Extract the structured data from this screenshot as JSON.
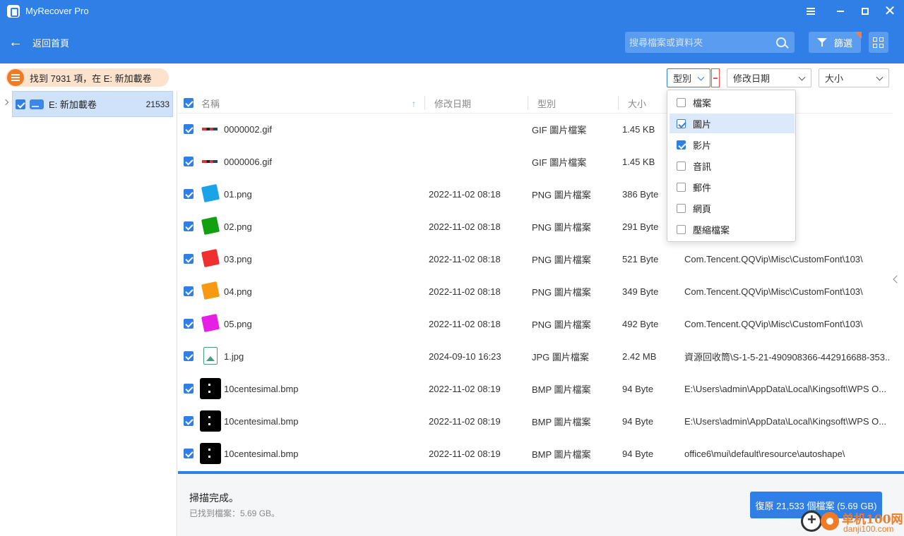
{
  "window": {
    "title": "MyRecover Pro"
  },
  "header": {
    "back_label": "返回首頁",
    "search_placeholder": "搜尋檔案或資料夾",
    "filter_label": "篩選"
  },
  "toolbar": {
    "summary": "找到 7931 項，在 E: 新加載卷",
    "type_dropdown": "型別",
    "date_dropdown": "修改日期",
    "size_dropdown": "大小"
  },
  "tree": {
    "drive_label": "E: 新加載卷",
    "drive_count": "21533"
  },
  "table": {
    "columns": {
      "name": "名稱",
      "date": "修改日期",
      "type": "型別",
      "size": "大小"
    },
    "rows": [
      {
        "name": "0000002.gif",
        "date": "",
        "type": "GIF 圖片檔案",
        "size": "1.45 KB",
        "path": "",
        "thumb": "gif"
      },
      {
        "name": "0000006.gif",
        "date": "",
        "type": "GIF 圖片檔案",
        "size": "1.45 KB",
        "path": "",
        "thumb": "gif"
      },
      {
        "name": "01.png",
        "date": "2022-11-02 08:18",
        "type": "PNG 圖片檔案",
        "size": "386 Byte",
        "path": "CustomFont\\103\\",
        "thumb": "#1aa3e8"
      },
      {
        "name": "02.png",
        "date": "2022-11-02 08:18",
        "type": "PNG 圖片檔案",
        "size": "291 Byte",
        "path": "CustomFont\\103\\",
        "thumb": "#10a010"
      },
      {
        "name": "03.png",
        "date": "2022-11-02 08:18",
        "type": "PNG 圖片檔案",
        "size": "521 Byte",
        "path": "Com.Tencent.QQVip\\Misc\\CustomFont\\103\\",
        "thumb": "#f03030"
      },
      {
        "name": "04.png",
        "date": "2022-11-02 08:18",
        "type": "PNG 圖片檔案",
        "size": "349 Byte",
        "path": "Com.Tencent.QQVip\\Misc\\CustomFont\\103\\",
        "thumb": "#f79a12"
      },
      {
        "name": "05.png",
        "date": "2022-11-02 08:18",
        "type": "PNG 圖片檔案",
        "size": "492 Byte",
        "path": "Com.Tencent.QQVip\\Misc\\CustomFont\\103\\",
        "thumb": "#e61ee6"
      },
      {
        "name": "1.jpg",
        "date": "2024-09-10 16:23",
        "type": "JPG 圖片檔案",
        "size": "2.42 MB",
        "path": "資源回收筒\\S-1-5-21-490908366-442916688-353...",
        "thumb": "jpg"
      },
      {
        "name": "10centesimal.bmp",
        "date": "2022-11-02 08:19",
        "type": "BMP 圖片檔案",
        "size": "94 Byte",
        "path": "E:\\Users\\admin\\AppData\\Local\\Kingsoft\\WPS O...",
        "thumb": "bmp"
      },
      {
        "name": "10centesimal.bmp",
        "date": "2022-11-02 08:19",
        "type": "BMP 圖片檔案",
        "size": "94 Byte",
        "path": "E:\\Users\\admin\\AppData\\Local\\Kingsoft\\WPS O...",
        "thumb": "bmp"
      },
      {
        "name": "10centesimal.bmp",
        "date": "2022-11-02 08:19",
        "type": "BMP 圖片檔案",
        "size": "94 Byte",
        "path": "office6\\mui\\default\\resource\\autoshape\\",
        "thumb": "bmp"
      }
    ]
  },
  "type_menu": {
    "items": [
      {
        "label": "檔案",
        "checked": false,
        "highlighted": false
      },
      {
        "label": "圖片",
        "checked": true,
        "highlighted": true
      },
      {
        "label": "影片",
        "checked": true,
        "highlighted": false
      },
      {
        "label": "音訊",
        "checked": false,
        "highlighted": false
      },
      {
        "label": "郵件",
        "checked": false,
        "highlighted": false
      },
      {
        "label": "網頁",
        "checked": false,
        "highlighted": false
      },
      {
        "label": "壓縮檔案",
        "checked": false,
        "highlighted": false
      }
    ]
  },
  "footer": {
    "status_title": "掃描完成。",
    "status_sub": "已找到檔案：5.69 GB。",
    "recover_button": "復原 21,533 個檔案 (5.69 GB)"
  },
  "watermark": {
    "text_cn": "单机100网",
    "text_url": "danji100.com"
  },
  "colors": {
    "primary": "#2f7fe6",
    "accent": "#f07a26",
    "danger": "#ff4d4f"
  }
}
